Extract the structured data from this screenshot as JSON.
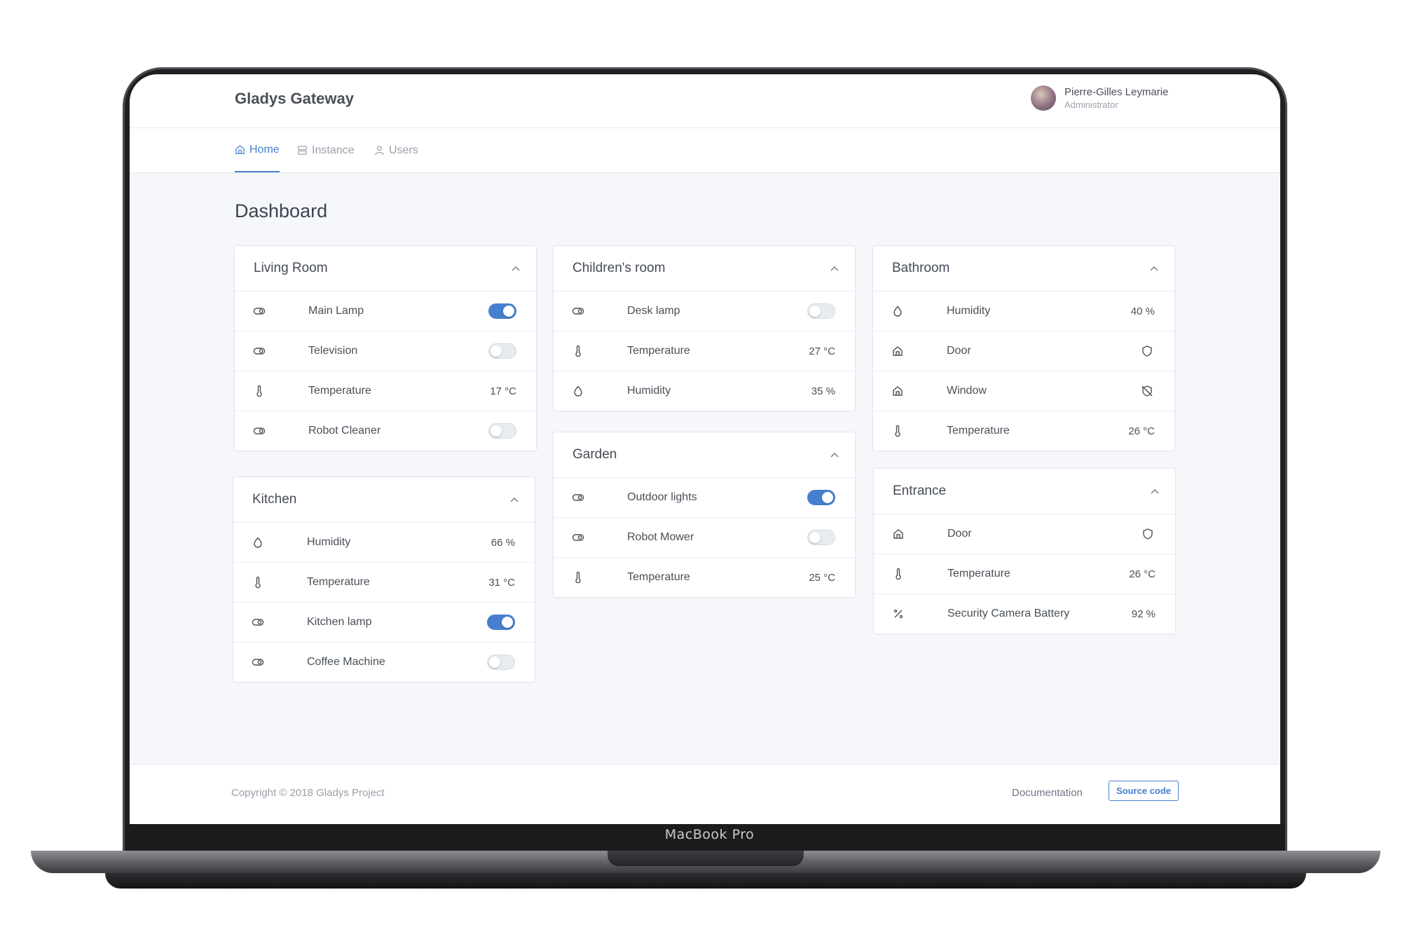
{
  "app": {
    "brand": "Gladys Gateway"
  },
  "user": {
    "name": "Pierre-Gilles Leymarie",
    "role": "Administrator"
  },
  "nav": {
    "items": [
      {
        "label": "Home",
        "icon": "home-icon",
        "active": true
      },
      {
        "label": "Instance",
        "icon": "server-icon",
        "active": false
      },
      {
        "label": "Users",
        "icon": "user-icon",
        "active": false
      }
    ]
  },
  "page": {
    "title": "Dashboard"
  },
  "rooms": {
    "living": {
      "title": "Living Room",
      "rows": [
        {
          "icon": "toggle-icon",
          "label": "Main Lamp",
          "type": "switch",
          "on": true
        },
        {
          "icon": "toggle-icon",
          "label": "Television",
          "type": "switch",
          "on": false
        },
        {
          "icon": "thermometer-icon",
          "label": "Temperature",
          "type": "value",
          "value": "17 °C"
        },
        {
          "icon": "toggle-icon",
          "label": "Robot Cleaner",
          "type": "switch",
          "on": false
        }
      ]
    },
    "kitchen": {
      "title": "Kitchen",
      "rows": [
        {
          "icon": "droplet-icon",
          "label": "Humidity",
          "type": "value",
          "value": "66 %"
        },
        {
          "icon": "thermometer-icon",
          "label": "Temperature",
          "type": "value",
          "value": "31 °C"
        },
        {
          "icon": "toggle-icon",
          "label": "Kitchen lamp",
          "type": "switch",
          "on": true
        },
        {
          "icon": "toggle-icon",
          "label": "Coffee Machine",
          "type": "switch",
          "on": false
        }
      ]
    },
    "children": {
      "title": "Children's room",
      "rows": [
        {
          "icon": "toggle-icon",
          "label": "Desk lamp",
          "type": "switch",
          "on": false
        },
        {
          "icon": "thermometer-icon",
          "label": "Temperature",
          "type": "value",
          "value": "27 °C"
        },
        {
          "icon": "droplet-icon",
          "label": "Humidity",
          "type": "value",
          "value": "35 %"
        }
      ]
    },
    "garden": {
      "title": "Garden",
      "rows": [
        {
          "icon": "toggle-icon",
          "label": "Outdoor lights",
          "type": "switch",
          "on": true
        },
        {
          "icon": "toggle-icon",
          "label": "Robot Mower",
          "type": "switch",
          "on": false
        },
        {
          "icon": "thermometer-icon",
          "label": "Temperature",
          "type": "value",
          "value": "25 °C"
        }
      ]
    },
    "bathroom": {
      "title": "Bathroom",
      "rows": [
        {
          "icon": "droplet-icon",
          "label": "Humidity",
          "type": "value",
          "value": "40 %"
        },
        {
          "icon": "home-icon",
          "label": "Door",
          "type": "status",
          "status": "shield-icon"
        },
        {
          "icon": "home-icon",
          "label": "Window",
          "type": "status",
          "status": "shield-off-icon"
        },
        {
          "icon": "thermometer-icon",
          "label": "Temperature",
          "type": "value",
          "value": "26 °C"
        }
      ]
    },
    "entrance": {
      "title": "Entrance",
      "rows": [
        {
          "icon": "home-icon",
          "label": "Door",
          "type": "status",
          "status": "shield-icon"
        },
        {
          "icon": "thermometer-icon",
          "label": "Temperature",
          "type": "value",
          "value": "26 °C"
        },
        {
          "icon": "percent-icon",
          "label": "Security Camera Battery",
          "type": "value",
          "value": "92 %"
        }
      ]
    }
  },
  "footer": {
    "copyright": "Copyright © 2018 Gladys Project",
    "documentation": "Documentation",
    "source_code": "Source code"
  },
  "device": {
    "label": "MacBook Pro"
  },
  "colors": {
    "accent": "#467fcf",
    "background": "#f5f7fb",
    "text": "#495057"
  }
}
